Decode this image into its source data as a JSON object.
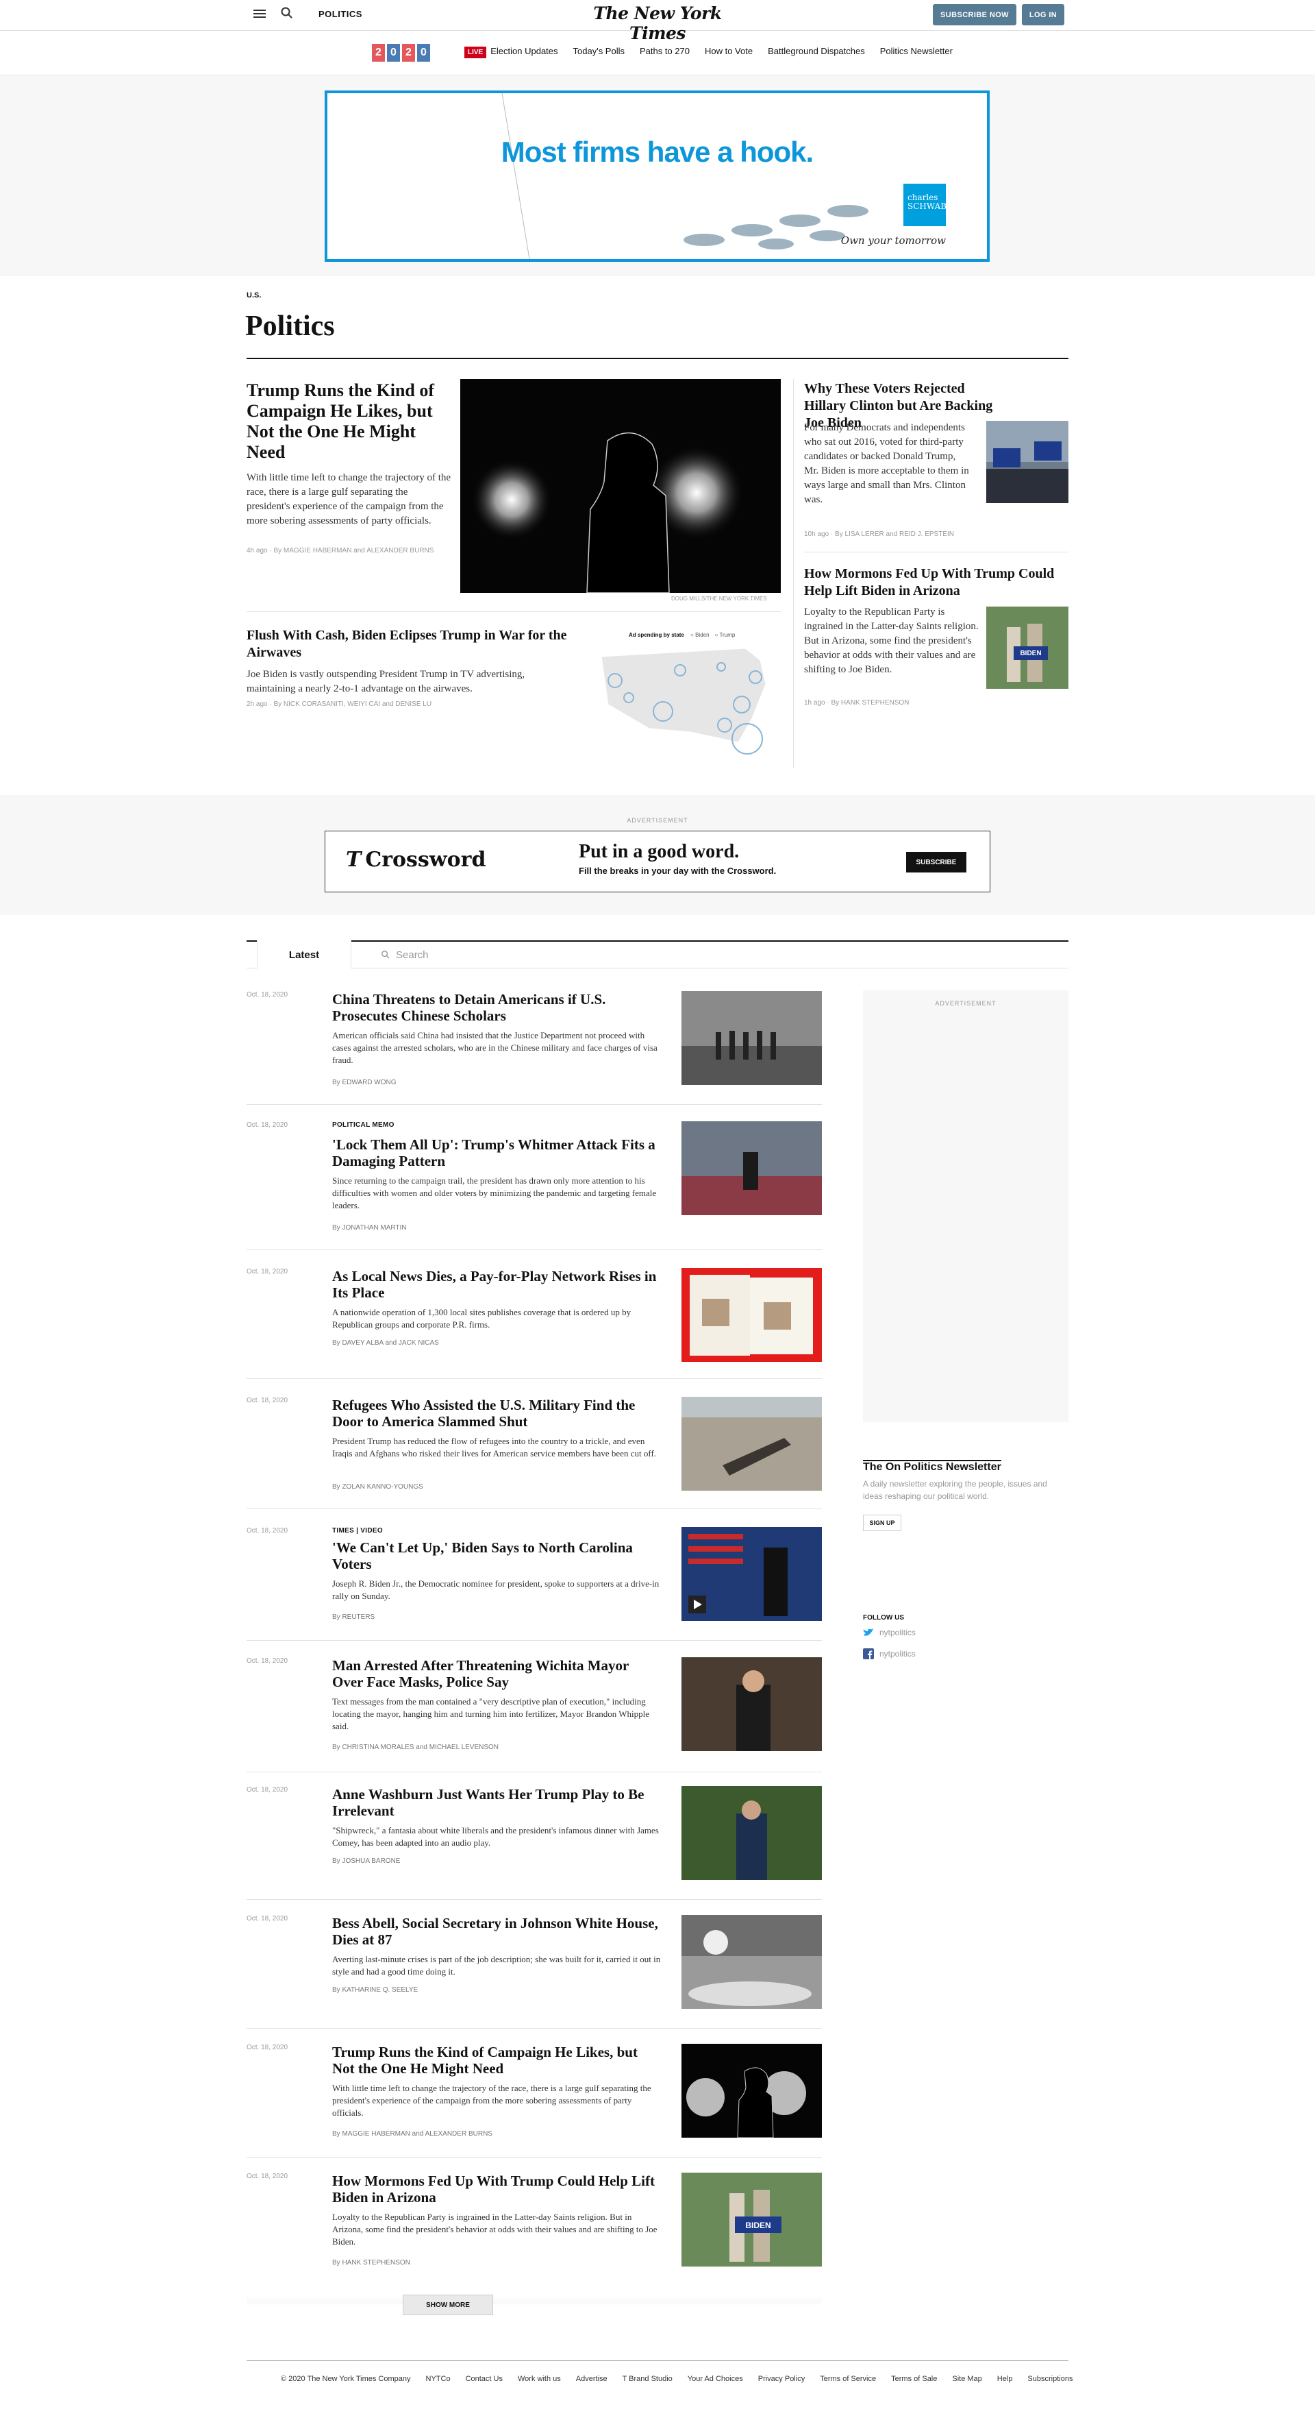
{
  "header": {
    "section": "POLITICS",
    "logo": "The New York Times",
    "subscribe": "SUBSCRIBE NOW",
    "login": "LOG IN"
  },
  "badge": [
    "2",
    "0",
    "2",
    "0"
  ],
  "nav": {
    "live": "LIVE",
    "items": [
      "Election Updates",
      "Today's Polls",
      "Paths to 270",
      "How to Vote",
      "Battleground Dispatches",
      "Politics Newsletter"
    ]
  },
  "ad1": {
    "headline": "Most firms have a hook.",
    "brand": "charles SCHWAB",
    "tagline": "Own your tomorrow"
  },
  "section": {
    "kicker": "U.S.",
    "title": "Politics"
  },
  "lede": {
    "main": {
      "headline": "Trump Runs the Kind of Campaign He Likes, but Not the One He Might Need",
      "summary": "With little time left to change the trajectory of the race, there is a large gulf separating the president's experience of the campaign from the more sobering assessments of party officials.",
      "meta": "4h ago · By MAGGIE HABERMAN and ALEXANDER BURNS",
      "credit": "DOUG MILLS/THE NEW YORK TIMES"
    },
    "second": {
      "headline": "Flush With Cash, Biden Eclipses Trump in War for the Airwaves",
      "summary": "Joe Biden is vastly outspending President Trump in TV advertising, maintaining a nearly 2-to-1 advantage on the airwaves.",
      "meta": "2h ago · By NICK CORASANITI, WEIYI CAI and DENISE LU",
      "map_title": "Ad spending by state",
      "map_legend": [
        "Biden",
        "Trump"
      ]
    },
    "right1": {
      "headline": "Why These Voters Rejected Hillary Clinton but Are Backing Joe Biden",
      "summary": "For many Democrats and independents who sat out 2016, voted for third-party candidates or backed Donald Trump, Mr. Biden is more acceptable to them in ways large and small than Mrs. Clinton was.",
      "meta": "10h ago · By LISA LERER and REID J. EPSTEIN"
    },
    "right2": {
      "headline": "How Mormons Fed Up With Trump Could Help Lift Biden in Arizona",
      "summary": "Loyalty to the Republican Party is ingrained in the Latter-day Saints religion. But in Arizona, some find the president's behavior at odds with their values and are shifting to Joe Biden.",
      "meta": "1h ago · By HANK STEPHENSON",
      "sign": "BIDEN"
    }
  },
  "ad2": {
    "label": "ADVERTISEMENT",
    "brand": "Crossword",
    "headline": "Put in a good word.",
    "sub": "Fill the breaks in your day with the Crossword.",
    "button": "SUBSCRIBE"
  },
  "tabs": {
    "latest": "Latest",
    "search_placeholder": "Search"
  },
  "stream": [
    {
      "date": "Oct. 18, 2020",
      "kicker": "",
      "headline": "China Threatens to Detain Americans if U.S. Prosecutes Chinese Scholars",
      "summary": "American officials said China had insisted that the Justice Department not proceed with cases against the arrested scholars, who are in the Chinese military and face charges of visa fraud.",
      "byline": "By EDWARD WONG"
    },
    {
      "date": "Oct. 18, 2020",
      "kicker": "POLITICAL MEMO",
      "headline": "'Lock Them All Up': Trump's Whitmer Attack Fits a Damaging Pattern",
      "summary": "Since returning to the campaign trail, the president has drawn only more attention to his difficulties with women and older voters by minimizing the pandemic and targeting female leaders.",
      "byline": "By JONATHAN MARTIN"
    },
    {
      "date": "Oct. 18, 2020",
      "kicker": "",
      "headline": "As Local News Dies, a Pay-for-Play Network Rises in Its Place",
      "summary": "A nationwide operation of 1,300 local sites publishes coverage that is ordered up by Republican groups and corporate P.R. firms.",
      "byline": "By DAVEY ALBA and JACK NICAS"
    },
    {
      "date": "Oct. 18, 2020",
      "kicker": "",
      "headline": "Refugees Who Assisted the U.S. Military Find the Door to America Slammed Shut",
      "summary": "President Trump has reduced the flow of refugees into the country to a trickle, and even Iraqis and Afghans who risked their lives for American service members have been cut off.",
      "byline": "By ZOLAN KANNO-YOUNGS"
    },
    {
      "date": "Oct. 18, 2020",
      "kicker": "TIMES | VIDEO",
      "headline": "'We Can't Let Up,' Biden Says to North Carolina Voters",
      "summary": "Joseph R. Biden Jr., the Democratic nominee for president, spoke to supporters at a drive-in rally on Sunday.",
      "byline": "By REUTERS"
    },
    {
      "date": "Oct. 18, 2020",
      "kicker": "",
      "headline": "Man Arrested After Threatening Wichita Mayor Over Face Masks, Police Say",
      "summary": "Text messages from the man contained a \"very descriptive plan of execution,\" including locating the mayor, hanging him and turning him into fertilizer, Mayor Brandon Whipple said.",
      "byline": "By CHRISTINA MORALES and MICHAEL LEVENSON"
    },
    {
      "date": "Oct. 18, 2020",
      "kicker": "",
      "headline": "Anne Washburn Just Wants Her Trump Play to Be Irrelevant",
      "summary": "\"Shipwreck,\" a fantasia about white liberals and the president's infamous dinner with James Comey, has been adapted into an audio play.",
      "byline": "By JOSHUA BARONE"
    },
    {
      "date": "Oct. 18, 2020",
      "kicker": "",
      "headline": "Bess Abell, Social Secretary in Johnson White House, Dies at 87",
      "summary": "Averting last-minute crises is part of the job description; she was built for it, carried it out in style and had a good time doing it.",
      "byline": "By KATHARINE Q. SEELYE"
    },
    {
      "date": "Oct. 18, 2020",
      "kicker": "",
      "headline": "Trump Runs the Kind of Campaign He Likes, but Not the One He Might Need",
      "summary": "With little time left to change the trajectory of the race, there is a large gulf separating the president's experience of the campaign from the more sobering assessments of party officials.",
      "byline": "By MAGGIE HABERMAN and ALEXANDER BURNS"
    },
    {
      "date": "Oct. 18, 2020",
      "kicker": "",
      "headline": "How Mormons Fed Up With Trump Could Help Lift Biden in Arizona",
      "summary": "Loyalty to the Republican Party is ingrained in the Latter-day Saints religion. But in Arizona, some find the president's behavior at odds with their values and are shifting to Joe Biden.",
      "byline": "By HANK STEPHENSON"
    }
  ],
  "sidebar": {
    "ad_label": "ADVERTISEMENT",
    "newsletter_title": "The On Politics Newsletter",
    "newsletter_desc": "A daily newsletter exploring the people, issues and ideas reshaping our political world.",
    "signup": "SIGN UP",
    "follow": "FOLLOW US",
    "twitter": "nytpolitics",
    "facebook": "nytpolitics"
  },
  "show_more": "SHOW MORE",
  "footer": [
    "© 2020 The New York Times Company",
    "NYTCo",
    "Contact Us",
    "Work with us",
    "Advertise",
    "T Brand Studio",
    "Your Ad Choices",
    "Privacy Policy",
    "Terms of Service",
    "Terms of Sale",
    "Site Map",
    "Help",
    "Subscriptions"
  ],
  "colors": {
    "accent": "#567b95",
    "live": "#d0021b",
    "schwab": "#0d96d9"
  }
}
